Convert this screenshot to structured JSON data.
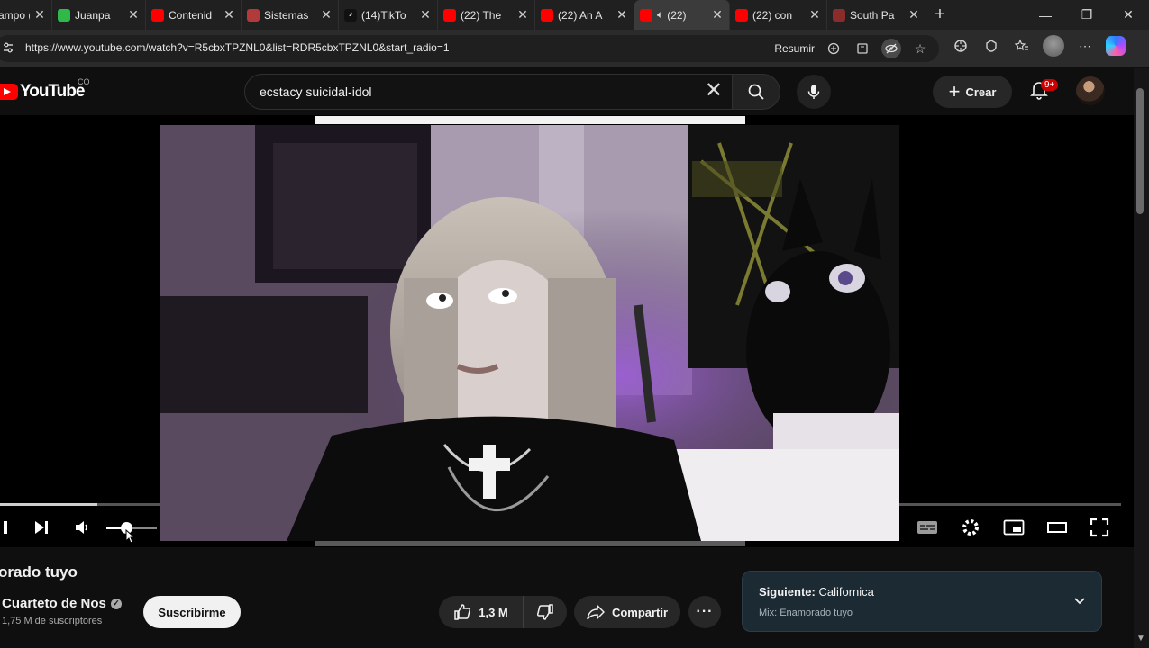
{
  "browser": {
    "tabs": [
      {
        "label": "ampo (",
        "favicon_color": "#d9d9d9"
      },
      {
        "label": "Juanpa",
        "favicon_color": "#2fb94a"
      },
      {
        "label": "Contenid",
        "favicon_color": "#ff0000"
      },
      {
        "label": "Sistemas",
        "favicon_color": "#b33a3a"
      },
      {
        "label": "(14)TikTo",
        "favicon_color": "#111111"
      },
      {
        "label": "(22) The",
        "favicon_color": "#ff0000"
      },
      {
        "label": "(22) An A",
        "favicon_color": "#ff0000"
      },
      {
        "label": "(22)",
        "favicon_color": "#ff0000",
        "active": true
      },
      {
        "label": "(22) con",
        "favicon_color": "#ff0000"
      },
      {
        "label": "South Pa",
        "favicon_color": "#8a2c2c"
      }
    ],
    "new_tab_icon": "plus-icon",
    "window_controls": [
      "minimize-icon",
      "restore-icon",
      "close-icon"
    ],
    "url": "https://www.youtube.com/watch?v=R5cbxTPZNL0&list=RDR5cbxTPZNL0&start_radio=1",
    "resume_label": "Resumir"
  },
  "youtube": {
    "logo_text": "YouTube",
    "country_code": "CO",
    "search_query": "ecstacy suicidal-idol",
    "create_label": "Crear",
    "notifications_badge": "9+",
    "brand_color": "#ff0000"
  },
  "player": {
    "progress_fraction": 0.09,
    "volume_fraction": 0.4
  },
  "video": {
    "title": "orado tuyo",
    "channel_name": "Cuarteto de Nos",
    "subscribers": "1,75 M de suscriptores",
    "subscribe_label": "Suscribirme",
    "likes": "1,3 M",
    "share_label": "Compartir",
    "more_label": "···"
  },
  "up_next": {
    "prefix": "Siguiente:",
    "title": "Californica",
    "mix_label": "Mix: Enamorado tuyo"
  }
}
